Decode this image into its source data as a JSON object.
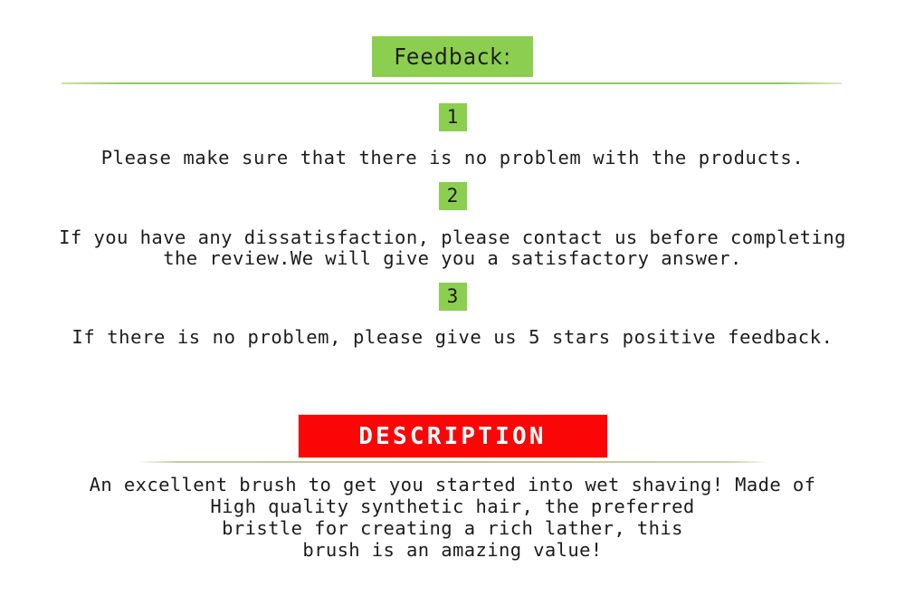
{
  "feedback": {
    "header_label": "Feedback:",
    "header_bg_color": "#8cce4f",
    "divider_color": "#8cce4f",
    "items": [
      {
        "number": "1",
        "text": "Please make sure that there is no problem with the products."
      },
      {
        "number": "2",
        "text": "If you have any dissatisfaction, please contact us before completing\nthe review.We will give you a satisfactory answer."
      },
      {
        "number": "3",
        "text": "If there is no problem, please give us 5 stars positive feedback."
      }
    ]
  },
  "description": {
    "banner_label": "DESCRIPTION",
    "banner_bg_color": "#fb0606",
    "banner_text_color": "#ffffff",
    "divider_color": "#b8c78b",
    "body": "An excellent brush to get you started into wet shaving! Made of\nHigh quality synthetic hair, the preferred\nbristle for creating a rich lather, this\nbrush is an amazing value!"
  }
}
